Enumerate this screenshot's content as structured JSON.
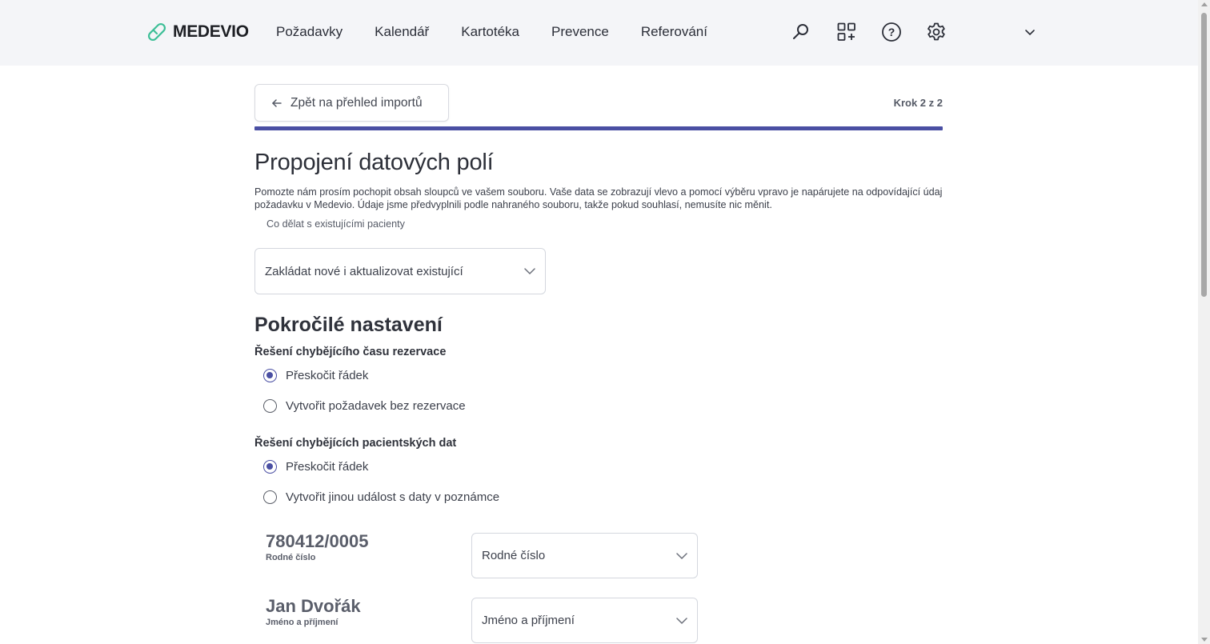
{
  "brand": {
    "name": "MEDEVIO",
    "color": "#3dbf97"
  },
  "nav": [
    "Požadavky",
    "Kalendář",
    "Kartotéka",
    "Prevence",
    "Referování"
  ],
  "top_icons": [
    "search-icon",
    "apps-add-icon",
    "help-icon",
    "settings-icon",
    "chevron-down-icon"
  ],
  "back_button": {
    "label": "Zpět na přehled importů"
  },
  "step": "Krok 2 z 2",
  "progress": 1.0,
  "accent": "#4a4fa3",
  "title": "Propojení datových polí",
  "description": "Pomozte nám prosím pochopit obsah sloupců ve vašem souboru. Vaše data se zobrazují vlevo a pomocí výběru vpravo je napárujete na odpovídající údaj požadavku v Medevio. Údaje jsme předvyplnili podle nahraného souboru, takže pokud souhlasí, nemusíte nic měnit.",
  "existing_patients": {
    "label": "Co dělat s existujícími pacienty",
    "selected": "Zakládat nové i aktualizovat existující"
  },
  "advanced": {
    "title": "Pokročilé nastavení",
    "groups": [
      {
        "label": "Řešení chybějícího času rezervace",
        "options": [
          "Přeskočit řádek",
          "Vytvořit požadavek bez rezervace"
        ],
        "selected": 0
      },
      {
        "label": "Řešení chybějících pacientských dat",
        "options": [
          "Přeskočit řádek",
          "Vytvořit jinou událost s daty v poznámce"
        ],
        "selected": 0
      }
    ]
  },
  "mappings": [
    {
      "value": "780412/0005",
      "label": "Rodné číslo",
      "selected": "Rodné číslo"
    },
    {
      "value": "Jan Dvořák",
      "label": "Jméno a příjmení",
      "selected": "Jméno a příjmení"
    }
  ]
}
